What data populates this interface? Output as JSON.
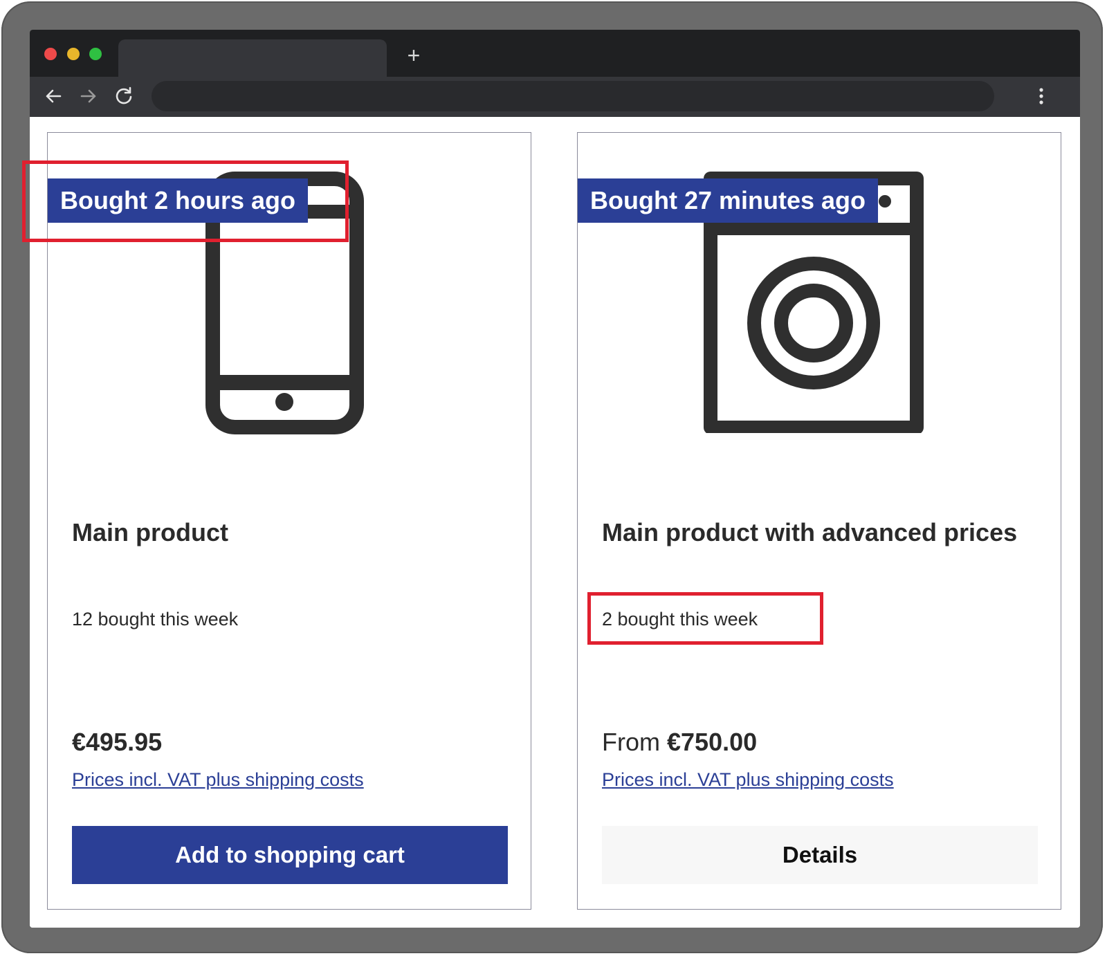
{
  "browser": {
    "new_tab_glyph": "+",
    "menu_glyph": "⋮"
  },
  "products": [
    {
      "badge": "Bought 2 hours ago",
      "image_icon": "smartphone-icon",
      "title": "Main product",
      "sales_count": "12 bought this week",
      "price_prefix": "",
      "price": "€495.95",
      "vat_link": "Prices incl. VAT plus shipping costs",
      "cta": "Add to shopping cart"
    },
    {
      "badge": "Bought 27 minutes ago",
      "image_icon": "washing-machine-icon",
      "title": "Main product with advanced prices",
      "sales_count": "2 bought this week",
      "price_prefix": "From ",
      "price": "€750.00",
      "vat_link": "Prices incl. VAT plus shipping costs",
      "cta": "Details"
    }
  ],
  "colors": {
    "brand": "#2b3f96",
    "highlight": "#e0202f",
    "text": "#2a2a2a",
    "chrome_dark": "#1f2022",
    "chrome_toolbar": "#35363a"
  }
}
